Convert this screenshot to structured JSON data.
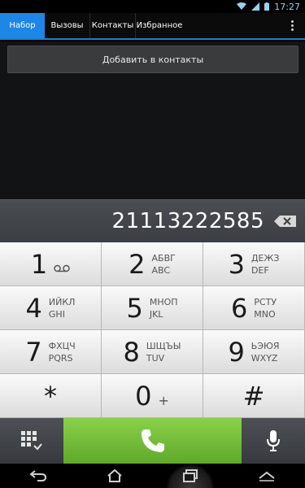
{
  "status_bar": {
    "time": "17:27",
    "icons": [
      "wifi-icon",
      "signal-icon",
      "battery-icon"
    ]
  },
  "tabs": [
    {
      "label": "Набор",
      "active": true
    },
    {
      "label": "Вызовы",
      "active": false
    },
    {
      "label": "Контакты",
      "active": false
    },
    {
      "label": "Избранное",
      "active": false
    }
  ],
  "actions": {
    "add_contact": "Добавить в контакты"
  },
  "dialer": {
    "number": "21113222585"
  },
  "keypad": {
    "k1": {
      "num": "1",
      "sub": "",
      "icon": "voicemail-icon"
    },
    "k2": {
      "num": "2",
      "top": "АБВГ",
      "bottom": "ABC"
    },
    "k3": {
      "num": "3",
      "top": "ДЕЖЗ",
      "bottom": "DEF"
    },
    "k4": {
      "num": "4",
      "top": "ИЙКЛ",
      "bottom": "GHI"
    },
    "k5": {
      "num": "5",
      "top": "МНОП",
      "bottom": "JKL"
    },
    "k6": {
      "num": "6",
      "top": "РСТУ",
      "bottom": "MNO"
    },
    "k7": {
      "num": "7",
      "top": "ФХЦЧ",
      "bottom": "PQRS"
    },
    "k8": {
      "num": "8",
      "top": "ШЩЪЫ",
      "bottom": "TUV"
    },
    "k9": {
      "num": "9",
      "top": "ЬЭЮЯ",
      "bottom": "WXYZ"
    },
    "kstar": {
      "num": "*"
    },
    "k0": {
      "num": "0",
      "sub": "+"
    },
    "khash": {
      "num": "#"
    }
  },
  "colors": {
    "accent": "#1e86e6",
    "call_green": "#6fbd35"
  }
}
